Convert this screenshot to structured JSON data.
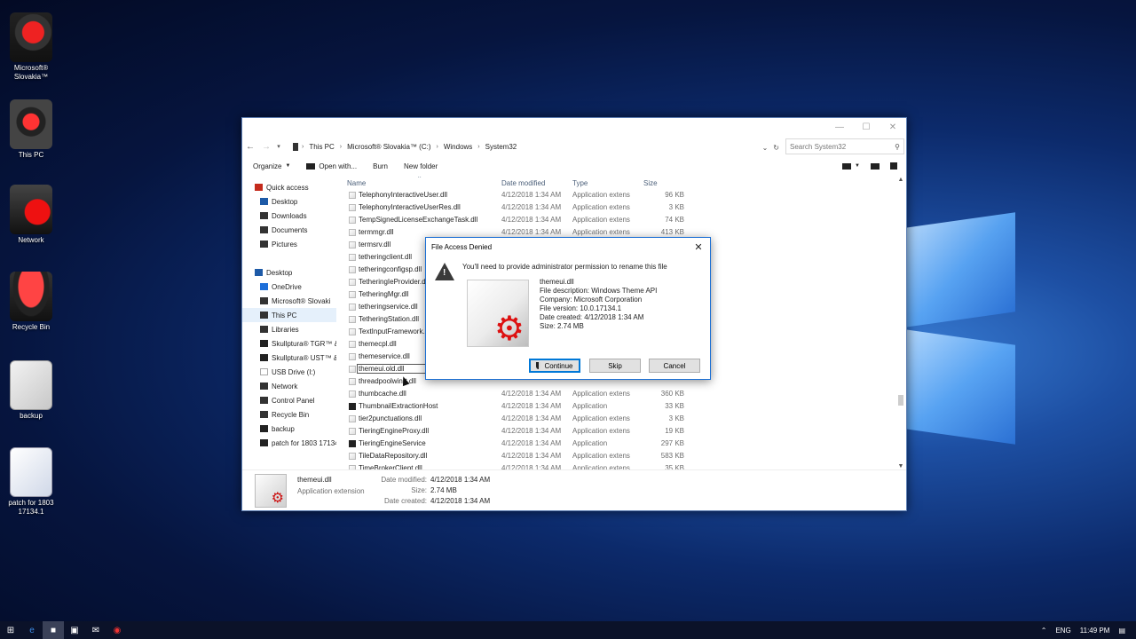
{
  "desktop": {
    "icons": [
      {
        "label": "Microsoft® Slovakia™"
      },
      {
        "label": "This PC"
      },
      {
        "label": "Network"
      },
      {
        "label": "Recycle Bin"
      },
      {
        "label": "backup"
      },
      {
        "label": "patch for 1803 17134.1"
      }
    ]
  },
  "explorer": {
    "breadcrumb": [
      "This PC",
      "Microsoft® Slovakia™ (C:)",
      "Windows",
      "System32"
    ],
    "search_placeholder": "Search System32",
    "toolbar": {
      "organize": "Organize",
      "open_with": "Open with...",
      "burn": "Burn",
      "new_folder": "New folder"
    },
    "nav_items": [
      {
        "label": "Quick access",
        "icon": "star-icon",
        "indent": 0,
        "color": "#c42b1c"
      },
      {
        "label": "Desktop",
        "icon": "folder-icon",
        "indent": 1,
        "color": "#1d5aa7"
      },
      {
        "label": "Downloads",
        "icon": "download-icon",
        "indent": 1,
        "color": "#333333"
      },
      {
        "label": "Documents",
        "icon": "document-icon",
        "indent": 1,
        "color": "#333333"
      },
      {
        "label": "Pictures",
        "icon": "picture-icon",
        "indent": 1,
        "color": "#333333"
      },
      {
        "label": "",
        "icon": "",
        "indent": 0,
        "color": ""
      },
      {
        "label": "Desktop",
        "icon": "desktop-icon",
        "indent": 0,
        "color": "#1d5aa7"
      },
      {
        "label": "OneDrive",
        "icon": "cloud-icon",
        "indent": 1,
        "color": "#1e6fd9"
      },
      {
        "label": "Microsoft® Slovaki",
        "icon": "user-icon",
        "indent": 1,
        "color": "#333333"
      },
      {
        "label": "This PC",
        "icon": "computer-icon",
        "indent": 1,
        "color": "#333333",
        "selected": true
      },
      {
        "label": "Libraries",
        "icon": "library-icon",
        "indent": 1,
        "color": "#333333"
      },
      {
        "label": "Skullptura® TGR™ &",
        "icon": "drive-icon",
        "indent": 1,
        "color": "#222222"
      },
      {
        "label": "Skullptura® UST™ &",
        "icon": "drive-icon",
        "indent": 1,
        "color": "#222222"
      },
      {
        "label": "USB Drive (I:)",
        "icon": "usb-icon",
        "indent": 1,
        "color": "#ffffff"
      },
      {
        "label": "Network",
        "icon": "network-icon",
        "indent": 1,
        "color": "#333333"
      },
      {
        "label": "Control Panel",
        "icon": "control-panel-icon",
        "indent": 1,
        "color": "#333333"
      },
      {
        "label": "Recycle Bin",
        "icon": "recycle-bin-icon",
        "indent": 1,
        "color": "#333333"
      },
      {
        "label": "backup",
        "icon": "folder-icon",
        "indent": 1,
        "color": "#222222"
      },
      {
        "label": "patch for 1803 17134",
        "icon": "folder-icon",
        "indent": 1,
        "color": "#222222"
      }
    ],
    "columns": {
      "name": "Name",
      "date": "Date modified",
      "type": "Type",
      "size": "Size"
    },
    "files": [
      {
        "name": "TelephonyInteractiveUser.dll",
        "date": "4/12/2018 1:34 AM",
        "type": "Application extens",
        "size": "96 KB",
        "app": false
      },
      {
        "name": "TelephonyInteractiveUserRes.dll",
        "date": "4/12/2018 1:34 AM",
        "type": "Application extens",
        "size": "3 KB",
        "app": false
      },
      {
        "name": "TempSignedLicenseExchangeTask.dll",
        "date": "4/12/2018 1:34 AM",
        "type": "Application extens",
        "size": "74 KB",
        "app": false
      },
      {
        "name": "termmgr.dll",
        "date": "4/12/2018 1:34 AM",
        "type": "Application extens",
        "size": "413 KB",
        "app": false
      },
      {
        "name": "termsrv.dll",
        "date": "",
        "type": "",
        "size": "",
        "app": false
      },
      {
        "name": "tetheringclient.dll",
        "date": "",
        "type": "",
        "size": "",
        "app": false
      },
      {
        "name": "tetheringconfigsp.dll",
        "date": "",
        "type": "",
        "size": "",
        "app": false
      },
      {
        "name": "TetheringIeProvider.d",
        "date": "",
        "type": "",
        "size": "",
        "app": false
      },
      {
        "name": "TetheringMgr.dll",
        "date": "",
        "type": "",
        "size": "",
        "app": false
      },
      {
        "name": "tetheringservice.dll",
        "date": "",
        "type": "",
        "size": "",
        "app": false
      },
      {
        "name": "TetheringStation.dll",
        "date": "",
        "type": "",
        "size": "",
        "app": false
      },
      {
        "name": "TextInputFramework.",
        "date": "",
        "type": "",
        "size": "",
        "app": false
      },
      {
        "name": "themecpl.dll",
        "date": "",
        "type": "",
        "size": "",
        "app": false
      },
      {
        "name": "themeservice.dll",
        "date": "",
        "type": "",
        "size": "",
        "app": false
      },
      {
        "name": "themeui.old.dll",
        "date": "",
        "type": "",
        "size": "",
        "app": false,
        "editing": true
      },
      {
        "name": "threadpoolwinrt.dll",
        "date": "",
        "type": "",
        "size": "",
        "app": false
      },
      {
        "name": "thumbcache.dll",
        "date": "4/12/2018 1:34 AM",
        "type": "Application extens",
        "size": "360 KB",
        "app": false
      },
      {
        "name": "ThumbnailExtractionHost",
        "date": "4/12/2018 1:34 AM",
        "type": "Application",
        "size": "33 KB",
        "app": true
      },
      {
        "name": "tier2punctuations.dll",
        "date": "4/12/2018 1:34 AM",
        "type": "Application extens",
        "size": "3 KB",
        "app": false
      },
      {
        "name": "TieringEngineProxy.dll",
        "date": "4/12/2018 1:34 AM",
        "type": "Application extens",
        "size": "19 KB",
        "app": false
      },
      {
        "name": "TieringEngineService",
        "date": "4/12/2018 1:34 AM",
        "type": "Application",
        "size": "297 KB",
        "app": true
      },
      {
        "name": "TileDataRepository.dll",
        "date": "4/12/2018 1:34 AM",
        "type": "Application extens",
        "size": "583 KB",
        "app": false
      },
      {
        "name": "TimeBrokerClient.dll",
        "date": "4/12/2018 1:34 AM",
        "type": "Application extens",
        "size": "35 KB",
        "app": false
      }
    ],
    "details": {
      "name": "themeui.dll",
      "type": "Application extension",
      "modified_label": "Date modified:",
      "modified": "4/12/2018 1:34 AM",
      "size_label": "Size:",
      "size": "2.74 MB",
      "created_label": "Date created:",
      "created": "4/12/2018 1:34 AM"
    }
  },
  "dialog": {
    "title": "File Access Denied",
    "message": "You'll need to provide administrator permission to rename this file",
    "info": [
      "themeui.dll",
      "File description: Windows Theme API",
      "Company: Microsoft Corporation",
      "File version: 10.0.17134.1",
      "Date created: 4/12/2018 1:34 AM",
      "Size: 2.74 MB"
    ],
    "buttons": {
      "continue": "Continue",
      "skip": "Skip",
      "cancel": "Cancel"
    }
  },
  "taskbar": {
    "language": "ENG",
    "time": "11:49 PM"
  }
}
